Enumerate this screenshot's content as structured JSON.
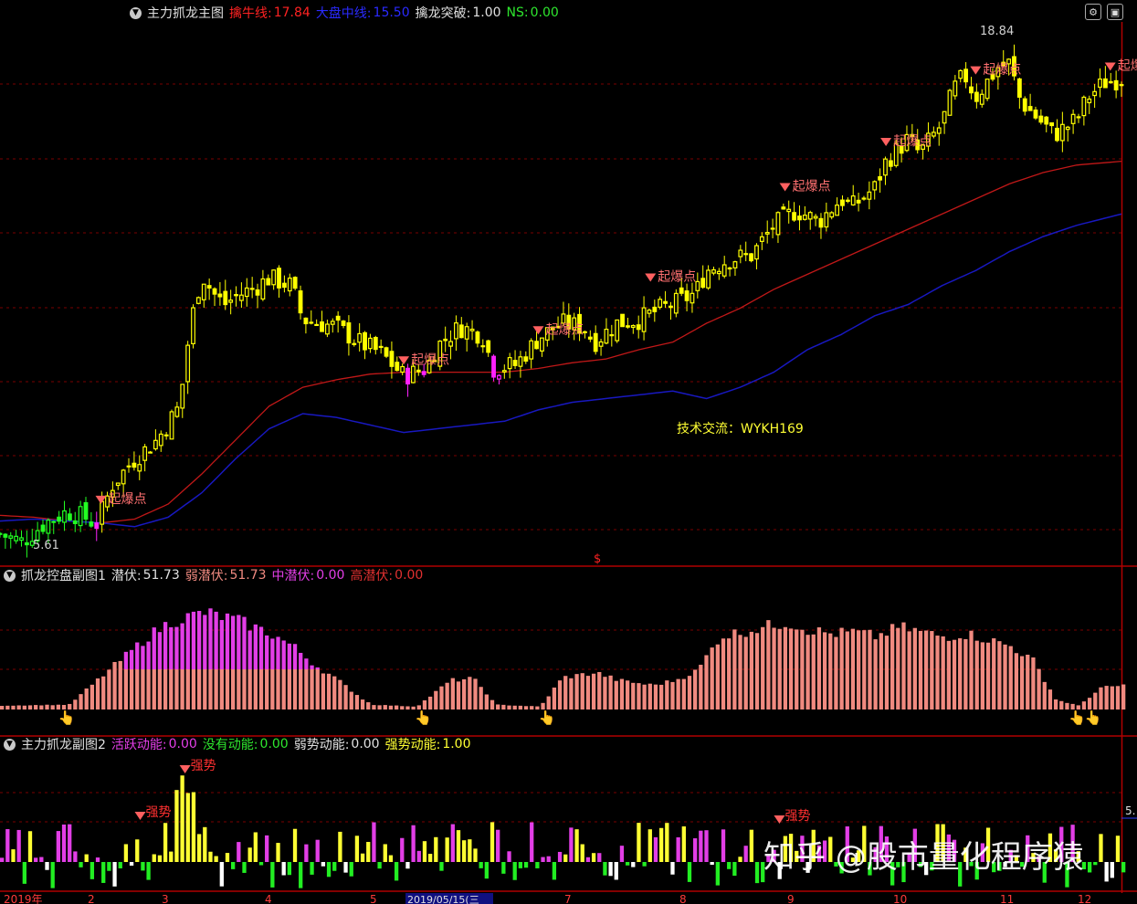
{
  "colors": {
    "bg": "#000000",
    "grid": "#7a0000",
    "panel_border": "#b00000",
    "candle_strong": "#ffff00",
    "candle_weak": "#ff22ff",
    "candle_start": "#22ff22",
    "line_red": "#c01818",
    "line_blue": "#1818c0",
    "bar_salmon": "#f08a80",
    "bar_magenta": "#e23ee6"
  },
  "main_panel": {
    "left_title": "主力抓龙主图",
    "ind1_label": "擒牛线:",
    "ind1_value": "17.84",
    "ind2_label": "大盘中线:",
    "ind2_value": "15.50",
    "ind3_label": "擒龙突破:",
    "ind3_value": "1.00",
    "ind4_label": "NS:",
    "ind4_value": "0.00",
    "high_label": "18.84",
    "low_label": "5.61",
    "signal_text": "起爆点",
    "contact_text": "技术交流：WYKH169",
    "dollar_mark": "$"
  },
  "sub1_panel": {
    "title": "抓龙控盘副图1",
    "ind1_label": "潜伏:",
    "ind1_value": "51.73",
    "ind2_label": "弱潜伏:",
    "ind2_value": "51.73",
    "ind3_label": "中潜伏:",
    "ind3_value": "0.00",
    "ind4_label": "高潜伏:",
    "ind4_value": "0.00"
  },
  "sub2_panel": {
    "title": "主力抓龙副图2",
    "ind1_label": "活跃动能:",
    "ind1_value": "0.00",
    "ind2_label": "没有动能:",
    "ind2_value": "0.00",
    "ind3_label": "弱势动能:",
    "ind3_value": "0.00",
    "ind4_label": "强势动能:",
    "ind4_value": "1.00",
    "strong_text": "强势",
    "right_edge_label": "5."
  },
  "axis": {
    "labels": [
      "2019年",
      "2",
      "3",
      "4",
      "5",
      "2019/05/15(三",
      "7",
      "8",
      "9",
      "10",
      "11",
      "12"
    ]
  },
  "watermark": "知乎 @股市量化程序猿",
  "chart_data": {
    "type": "candlestick",
    "y_range": [
      5.2,
      19.6
    ],
    "low": 5.61,
    "high": 18.84,
    "support_line": [
      [
        0,
        6.5
      ],
      [
        0.03,
        6.45
      ],
      [
        0.06,
        6.35
      ],
      [
        0.09,
        6.3
      ],
      [
        0.12,
        6.4
      ],
      [
        0.15,
        6.8
      ],
      [
        0.18,
        7.6
      ],
      [
        0.21,
        8.5
      ],
      [
        0.24,
        9.4
      ],
      [
        0.27,
        9.9
      ],
      [
        0.3,
        10.1
      ],
      [
        0.33,
        10.25
      ],
      [
        0.36,
        10.3
      ],
      [
        0.39,
        10.3
      ],
      [
        0.42,
        10.3
      ],
      [
        0.45,
        10.3
      ],
      [
        0.48,
        10.4
      ],
      [
        0.51,
        10.55
      ],
      [
        0.54,
        10.65
      ],
      [
        0.57,
        10.9
      ],
      [
        0.6,
        11.1
      ],
      [
        0.63,
        11.6
      ],
      [
        0.66,
        12.0
      ],
      [
        0.69,
        12.5
      ],
      [
        0.72,
        12.9
      ],
      [
        0.75,
        13.3
      ],
      [
        0.78,
        13.7
      ],
      [
        0.81,
        14.1
      ],
      [
        0.84,
        14.5
      ],
      [
        0.87,
        14.9
      ],
      [
        0.9,
        15.3
      ],
      [
        0.93,
        15.6
      ],
      [
        0.96,
        15.8
      ],
      [
        1.0,
        15.9
      ]
    ],
    "base_line": [
      [
        0,
        6.35
      ],
      [
        0.03,
        6.4
      ],
      [
        0.06,
        6.35
      ],
      [
        0.09,
        6.3
      ],
      [
        0.12,
        6.2
      ],
      [
        0.15,
        6.45
      ],
      [
        0.18,
        7.1
      ],
      [
        0.21,
        8.0
      ],
      [
        0.24,
        8.8
      ],
      [
        0.27,
        9.2
      ],
      [
        0.3,
        9.1
      ],
      [
        0.33,
        8.9
      ],
      [
        0.36,
        8.7
      ],
      [
        0.39,
        8.8
      ],
      [
        0.42,
        8.9
      ],
      [
        0.45,
        9.0
      ],
      [
        0.48,
        9.3
      ],
      [
        0.51,
        9.5
      ],
      [
        0.54,
        9.6
      ],
      [
        0.57,
        9.7
      ],
      [
        0.6,
        9.8
      ],
      [
        0.63,
        9.6
      ],
      [
        0.66,
        9.9
      ],
      [
        0.69,
        10.3
      ],
      [
        0.72,
        10.9
      ],
      [
        0.75,
        11.3
      ],
      [
        0.78,
        11.8
      ],
      [
        0.81,
        12.1
      ],
      [
        0.84,
        12.6
      ],
      [
        0.87,
        13.0
      ],
      [
        0.9,
        13.5
      ],
      [
        0.93,
        13.9
      ],
      [
        0.96,
        14.2
      ],
      [
        1.0,
        14.5
      ]
    ],
    "close_path": [
      [
        0,
        6.0
      ],
      [
        0.02,
        5.8
      ],
      [
        0.04,
        6.3
      ],
      [
        0.06,
        6.6
      ],
      [
        0.08,
        6.4
      ],
      [
        0.085,
        6.2
      ],
      [
        0.1,
        7.3
      ],
      [
        0.12,
        8.0
      ],
      [
        0.14,
        8.5
      ],
      [
        0.16,
        9.4
      ],
      [
        0.17,
        11.6
      ],
      [
        0.18,
        12.9
      ],
      [
        0.19,
        12.4
      ],
      [
        0.2,
        12.1
      ],
      [
        0.21,
        12.3
      ],
      [
        0.23,
        12.6
      ],
      [
        0.24,
        12.8
      ],
      [
        0.26,
        12.6
      ],
      [
        0.27,
        11.7
      ],
      [
        0.3,
        11.5
      ],
      [
        0.32,
        11.1
      ],
      [
        0.34,
        10.8
      ],
      [
        0.36,
        10.2
      ],
      [
        0.38,
        10.4
      ],
      [
        0.39,
        11.0
      ],
      [
        0.41,
        11.5
      ],
      [
        0.43,
        11.3
      ],
      [
        0.44,
        10.4
      ],
      [
        0.46,
        10.5
      ],
      [
        0.48,
        11.2
      ],
      [
        0.5,
        11.6
      ],
      [
        0.52,
        11.5
      ],
      [
        0.53,
        11.1
      ],
      [
        0.55,
        11.6
      ],
      [
        0.57,
        11.7
      ],
      [
        0.59,
        12.0
      ],
      [
        0.6,
        12.1
      ],
      [
        0.62,
        12.4
      ],
      [
        0.63,
        13.0
      ],
      [
        0.65,
        13.3
      ],
      [
        0.67,
        13.4
      ],
      [
        0.69,
        14.2
      ],
      [
        0.71,
        14.6
      ],
      [
        0.73,
        14.3
      ],
      [
        0.75,
        14.9
      ],
      [
        0.76,
        14.7
      ],
      [
        0.78,
        15.2
      ],
      [
        0.79,
        15.9
      ],
      [
        0.81,
        16.5
      ],
      [
        0.82,
        16.1
      ],
      [
        0.84,
        16.9
      ],
      [
        0.85,
        17.8
      ],
      [
        0.86,
        18.2
      ],
      [
        0.87,
        17.6
      ],
      [
        0.89,
        18.4
      ],
      [
        0.9,
        18.5
      ],
      [
        0.91,
        17.5
      ],
      [
        0.93,
        16.9
      ],
      [
        0.94,
        16.6
      ],
      [
        0.96,
        17.0
      ],
      [
        0.97,
        17.6
      ],
      [
        0.985,
        18.0
      ],
      [
        1.0,
        18.1
      ]
    ],
    "sub1_profile": [
      [
        0,
        0.04
      ],
      [
        0.06,
        0.05
      ],
      [
        0.09,
        0.35
      ],
      [
        0.11,
        0.55
      ],
      [
        0.13,
        0.75
      ],
      [
        0.15,
        0.9
      ],
      [
        0.18,
        1.0
      ],
      [
        0.21,
        0.92
      ],
      [
        0.24,
        0.78
      ],
      [
        0.26,
        0.65
      ],
      [
        0.28,
        0.45
      ],
      [
        0.3,
        0.3
      ],
      [
        0.32,
        0.12
      ],
      [
        0.33,
        0.05
      ],
      [
        0.37,
        0.03
      ],
      [
        0.4,
        0.3
      ],
      [
        0.42,
        0.32
      ],
      [
        0.43,
        0.2
      ],
      [
        0.44,
        0.05
      ],
      [
        0.48,
        0.03
      ],
      [
        0.5,
        0.33
      ],
      [
        0.53,
        0.38
      ],
      [
        0.55,
        0.3
      ],
      [
        0.58,
        0.25
      ],
      [
        0.6,
        0.3
      ],
      [
        0.62,
        0.4
      ],
      [
        0.64,
        0.75
      ],
      [
        0.66,
        0.8
      ],
      [
        0.68,
        0.85
      ],
      [
        0.7,
        0.9
      ],
      [
        0.72,
        0.82
      ],
      [
        0.74,
        0.78
      ],
      [
        0.76,
        0.8
      ],
      [
        0.78,
        0.75
      ],
      [
        0.8,
        0.85
      ],
      [
        0.82,
        0.8
      ],
      [
        0.84,
        0.75
      ],
      [
        0.86,
        0.78
      ],
      [
        0.88,
        0.72
      ],
      [
        0.9,
        0.65
      ],
      [
        0.92,
        0.5
      ],
      [
        0.94,
        0.1
      ],
      [
        0.96,
        0.04
      ],
      [
        0.98,
        0.22
      ],
      [
        1.0,
        0.25
      ]
    ]
  }
}
